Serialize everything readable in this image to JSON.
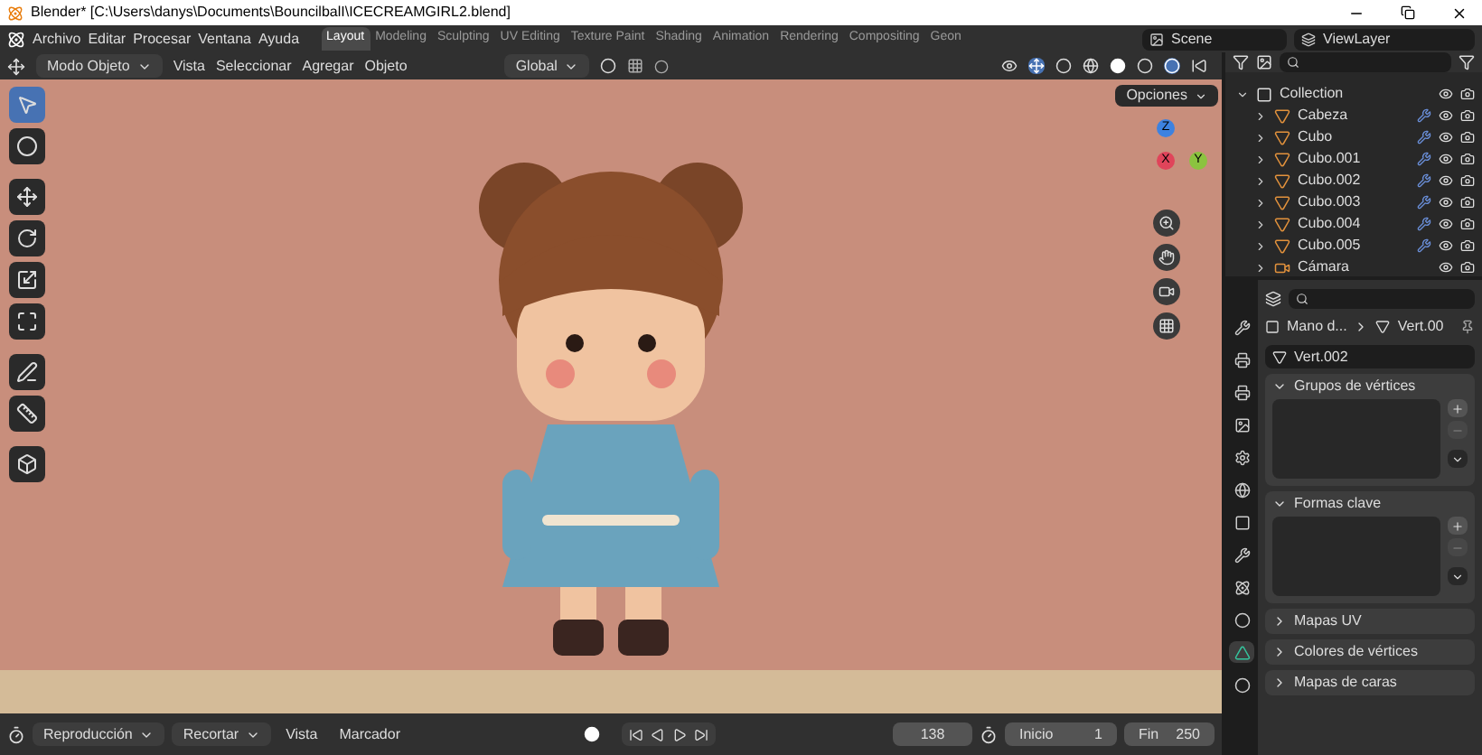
{
  "window": {
    "title": "Blender* [C:\\Users\\danys\\Documents\\BouncilbalI\\ICECREAMGIRL2.blend]"
  },
  "menu": [
    "Archivo",
    "Editar",
    "Procesar",
    "Ventana",
    "Ayuda"
  ],
  "workspaces": [
    {
      "label": "Layout",
      "selected": true
    },
    {
      "label": "Modeling",
      "selected": false
    },
    {
      "label": "Sculpting",
      "selected": false
    },
    {
      "label": "UV Editing",
      "selected": false
    },
    {
      "label": "Texture Paint",
      "selected": false
    },
    {
      "label": "Shading",
      "selected": false
    },
    {
      "label": "Animation",
      "selected": false
    },
    {
      "label": "Rendering",
      "selected": false
    },
    {
      "label": "Compositing",
      "selected": false
    },
    {
      "label": "Geon",
      "selected": false
    }
  ],
  "scene": "Scene",
  "view_layer": "ViewLayer",
  "viewport_header": {
    "mode": "Modo Objeto",
    "menus": [
      "Vista",
      "Seleccionar",
      "Agregar",
      "Objeto"
    ],
    "orientation": "Global"
  },
  "options": "Opciones",
  "gizmo": {
    "axes": [
      "X",
      "Y",
      "Z"
    ]
  },
  "outliner": [
    {
      "name": "Collection",
      "kind": "collection",
      "expanded": true,
      "children": [
        {
          "name": "Cabeza",
          "kind": "mesh",
          "expanded": false
        },
        {
          "name": "Cubo",
          "kind": "mesh",
          "expanded": false
        },
        {
          "name": "Cubo.001",
          "kind": "mesh",
          "expanded": false
        },
        {
          "name": "Cubo.002",
          "kind": "mesh",
          "expanded": false
        },
        {
          "name": "Cubo.003",
          "kind": "mesh",
          "expanded": false
        },
        {
          "name": "Cubo.004",
          "kind": "mesh",
          "expanded": false
        },
        {
          "name": "Cubo.005",
          "kind": "mesh",
          "expanded": false
        },
        {
          "name": "Cámara",
          "kind": "camera",
          "expanded": false
        }
      ]
    }
  ],
  "properties": {
    "object": "Mano d...",
    "mesh": "Vert.00",
    "datablock": "Vert.002",
    "panels": [
      {
        "title": "Grupos de vértices",
        "expanded": true
      },
      {
        "title": "Formas clave",
        "expanded": true
      },
      {
        "title": "Mapas UV",
        "expanded": false
      },
      {
        "title": "Colores de vértices",
        "expanded": false
      },
      {
        "title": "Mapas de caras",
        "expanded": false
      }
    ]
  },
  "timeline": {
    "menus": [
      "Reproducción",
      "Recortar",
      "Vista",
      "Marcador"
    ],
    "current_frame": "138",
    "start_label": "Inicio",
    "start": "1",
    "end_label": "Fin",
    "end": "250"
  }
}
